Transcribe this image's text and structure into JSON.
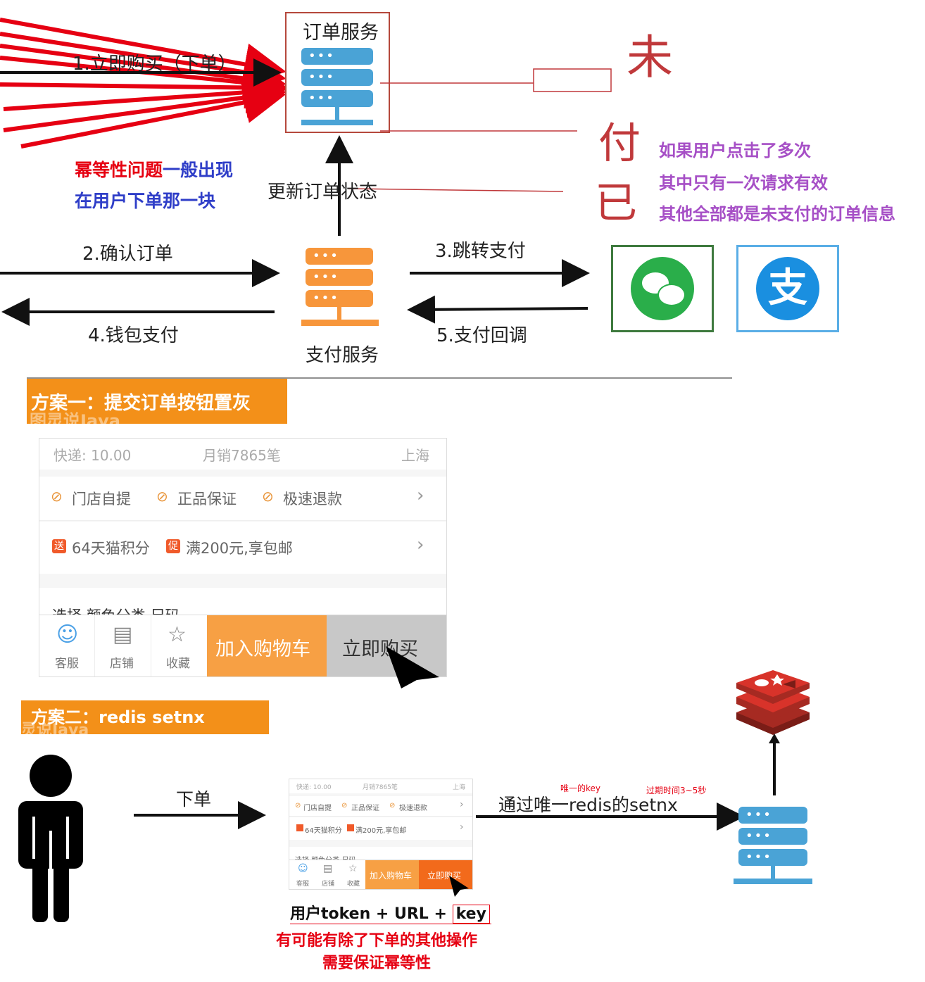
{
  "top": {
    "order_service": "订单服务",
    "buy_now": "1.立即购买（下单）",
    "confirm_order": "2.确认订单",
    "jump_pay": "3.跳转支付",
    "wallet_pay": "4.钱包支付",
    "pay_callback": "5.支付回调",
    "pay_service": "支付服务",
    "update_status": "更新订单状态",
    "idem_line1a": "幂等性问题",
    "idem_line1b": "一般出现",
    "idem_line2": "在用户下单那一块",
    "multi_click_1": "如果用户点击了多次",
    "multi_click_2": "其中只有一次请求有效",
    "multi_click_3": "其他全部都是未支付的订单信息",
    "handwritten_1": "未",
    "handwritten_2": "付",
    "handwritten_3": "已",
    "wechat_icon": "wechat-icon",
    "alipay_glyph": "支"
  },
  "plan1": {
    "banner": "方案一：提交订单按钮置灰",
    "watermark": "图灵说Java",
    "shipping": "快递: 10.00",
    "monthly_sales": "月销7865笔",
    "location": "上海",
    "feature_1": "门店自提",
    "feature_2": "正品保证",
    "feature_3": "极速退款",
    "promo_1_tag": "送",
    "promo_1": "64天猫积分",
    "promo_2_tag": "促",
    "promo_2": "满200元,享包邮",
    "select_row": "选择 颜色分类 尺码",
    "tab_service": "客服",
    "tab_store": "店铺",
    "tab_fav": "收藏",
    "add_cart": "加入购物车",
    "buy_now": "立即购买"
  },
  "plan2": {
    "banner": "方案二：redis setnx",
    "watermark": "灵说Java",
    "place_order": "下单",
    "via_setnx": "通过唯一redis的setnx",
    "unique_key": "唯一的key",
    "expire": "过期时间3~5秒",
    "token_text": "用户token + URL + ",
    "key_text": "key",
    "note_1": "有可能有除了下单的其他操作",
    "note_2": "需要保证幂等性",
    "mini_shipping": "快递: 10.00",
    "mini_sales": "月销7865笔",
    "mini_location": "上海",
    "mini_f1": "门店自提",
    "mini_f2": "正品保证",
    "mini_f3": "极速退款",
    "mini_p1": "64天猫积分",
    "mini_p2": "满200元,享包邮",
    "mini_select": "选择 颜色分类 尺码",
    "mini_tab1": "客服",
    "mini_tab2": "店铺",
    "mini_tab3": "收藏",
    "mini_cart": "加入购物车",
    "mini_buy": "立即购买"
  },
  "colors": {
    "server_blue": "#4aa3d6",
    "server_orange": "#f7963b",
    "red": "#e60012",
    "blue_text": "#2f3ec8",
    "purple": "#a64fc6",
    "banner_orange": "#f39019",
    "redis_red": "#d8332a"
  }
}
